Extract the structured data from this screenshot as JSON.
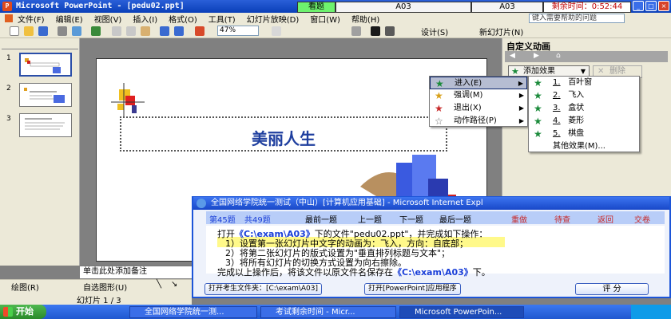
{
  "window": {
    "title": "Microsoft PowerPoint - [pedu02.ppt]",
    "app_icon": "P"
  },
  "exam_bar": {
    "look_label": "看题",
    "exam_id_1": "A03",
    "exam_id_2": "A03",
    "timer_text": "剩余时间：0:52:44"
  },
  "menubar": {
    "items": [
      "文件(F)",
      "编辑(E)",
      "视图(V)",
      "插入(I)",
      "格式(O)",
      "工具(T)",
      "幻灯片放映(D)",
      "窗口(W)",
      "帮助(H)"
    ],
    "help_placeholder": "键入需要帮助的问题"
  },
  "toolbar": {
    "zoom": "47%",
    "design_label": "设计(S)",
    "new_slide_label": "新幻灯片(N)"
  },
  "slides_panel": {
    "numbers": [
      "1",
      "2",
      "3"
    ]
  },
  "slide": {
    "title": "美丽人生"
  },
  "notes": {
    "placeholder": "单击此处添加备注"
  },
  "task_pane": {
    "title": "自定义动画",
    "add_effect_label": "添加效果",
    "remove_label": "删除"
  },
  "context_menu": {
    "items": [
      {
        "label": "进入(E)",
        "color": "#1a8a3a"
      },
      {
        "label": "强调(M)",
        "color": "#d8a018"
      },
      {
        "label": "退出(X)",
        "color": "#c82a2a"
      },
      {
        "label": "动作路径(P)",
        "color": "#6a6a6a"
      }
    ]
  },
  "submenu": {
    "items": [
      {
        "num": "1.",
        "label": "百叶窗"
      },
      {
        "num": "2.",
        "label": "飞入"
      },
      {
        "num": "3.",
        "label": "盒状"
      },
      {
        "num": "4.",
        "label": "菱形"
      },
      {
        "num": "5.",
        "label": "棋盘"
      }
    ],
    "more_label": "其他效果(M)..."
  },
  "dialog": {
    "title": "全国网络学院统一测试（中山）[计算机应用基础] - Microsoft Internet Expl",
    "question_no": "第45题",
    "question_total": "共49题",
    "nav": [
      "最前一题",
      "上一题",
      "下一题",
      "最后一题"
    ],
    "actions": [
      "重做",
      "待查",
      "返回",
      "交卷"
    ],
    "line1_pre": "打开",
    "line1_path": "《C:\\exam\\A03》",
    "line1_post": "下的文件\"pedu02.ppt\"，并完成如下操作：",
    "line2": "1）设置第一张幻灯片中文字的动画为：飞入，方向：自底部；",
    "line3": "2）将第二张幻灯片的版式设置为\"垂直排列标题与文本\"；",
    "line4": "3）将所有幻灯片的切换方式设置为向右擦除。",
    "line5_pre": "完成以上操作后，将该文件以原文件名保存在",
    "line5_path": "《C:\\exam\\A03》",
    "line5_post": "下。",
    "open_folder_btn": "打开考生文件夹：[C:\\exam\\A03]",
    "open_app_btn": "打开[PowerPoint]应用程序",
    "score_btn": "评 分"
  },
  "drawbar": {
    "draw_label": "绘图(R)",
    "autoshape_label": "自选图形(U)"
  },
  "status": {
    "slide_info": "幻灯片 1 / 3"
  },
  "taskbar": {
    "start_label": "开始",
    "tasks": [
      "全国网络学院统一测...",
      "考试剩余时间 - Micr...",
      "Microsoft PowerPoin..."
    ]
  }
}
